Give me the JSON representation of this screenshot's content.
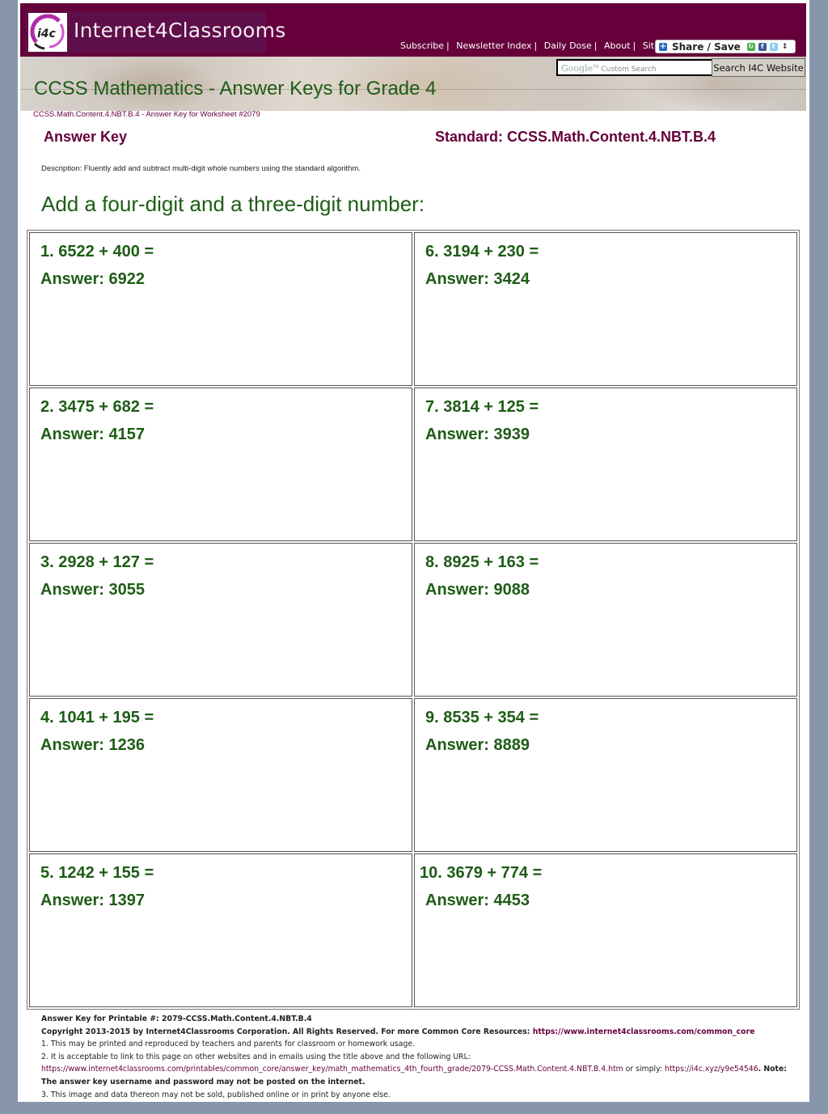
{
  "header": {
    "logo_text": "Internet4Classrooms",
    "logo_badge": "i4c",
    "nav": [
      {
        "label": "Subscribe"
      },
      {
        "label": "Newsletter Index"
      },
      {
        "label": "Daily Dose"
      },
      {
        "label": "About"
      },
      {
        "label": "Site Map"
      }
    ],
    "share_label": "Share / Save",
    "search": {
      "brand": "Google",
      "placeholder": "Custom Search",
      "value": "",
      "button_label": "Search I4C Website"
    }
  },
  "banner": {
    "title": "CCSS Mathematics - Answer Keys for Grade 4"
  },
  "breadcrumb": "CCSS.Math.Content.4.NBT.B.4 - Answer Key for Worksheet #2079",
  "answer_key_label": "Answer Key",
  "standard_label": "Standard: CCSS.Math.Content.4.NBT.B.4",
  "description": "Description: Fluently add and subtract multi-digit whole numbers using the standard algorithm.",
  "section_heading": "Add a four-digit and a three-digit number:",
  "problems": [
    {
      "question": "1. 6522 + 400 =",
      "answer": "Answer: 6922"
    },
    {
      "question": "6. 3194 + 230 =",
      "answer": "Answer: 3424"
    },
    {
      "question": "2. 3475 + 682 =",
      "answer": "Answer: 4157"
    },
    {
      "question": "7. 3814 + 125 =",
      "answer": "Answer: 3939"
    },
    {
      "question": "3. 2928 + 127 =",
      "answer": "Answer: 3055"
    },
    {
      "question": "8. 8925 + 163 =",
      "answer": "Answer: 9088"
    },
    {
      "question": "4. 1041 + 195 =",
      "answer": "Answer: 1236"
    },
    {
      "question": "9. 8535 + 354 =",
      "answer": "Answer: 8889"
    },
    {
      "question": "5. 1242 + 155 =",
      "answer": "Answer: 1397"
    },
    {
      "question": "10. 3679 + 774 =",
      "answer": "Answer: 4453"
    }
  ],
  "footer": {
    "printable_line": "Answer Key for Printable #: 2079-CCSS.Math.Content.4.NBT.B.4",
    "copyright_text": "Copyright 2013-2015 by Internet4Classrooms Corporation. All Rights Reserved. For more Common Core Resources: ",
    "copyright_link": "https://www.internet4classrooms.com/common_core",
    "note1": "1. This may be printed and reproduced by teachers and parents for classroom or homework usage.",
    "note2": "2. It is acceptable to link to this page on other websites and in emails using the title above and the following URL:",
    "note2_url": "https://www.internet4classrooms.com/printables/common_core/answer_key/math_mathematics_4th_fourth_grade/2079-CCSS.Math.Content.4.NBT.B.4.htm",
    "note2_or": " or simply: ",
    "note2_short_url": "https://i4c.xyz/y9e54546",
    "note2_warning": ". Note: The answer key username and password may not be posted on the internet.",
    "note3": "3. This image and data thereon may not be sold, published online or in print by anyone else."
  },
  "colors": {
    "brand": "#66003a",
    "heading_green": "#1e5c16",
    "outer_background": "#8896ab"
  }
}
